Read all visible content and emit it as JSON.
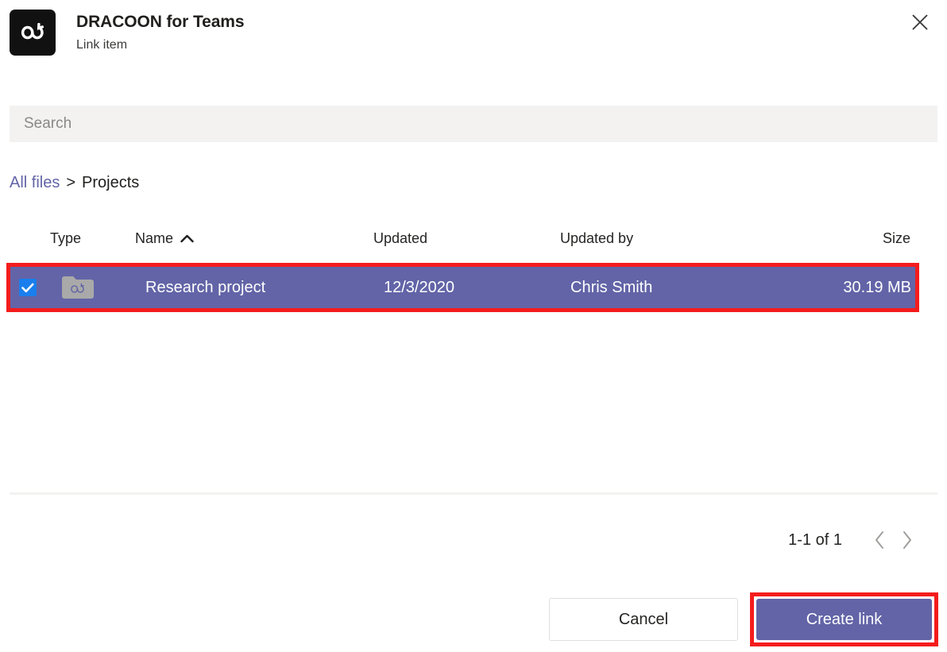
{
  "header": {
    "app_title": "DRACOON for Teams",
    "subtitle": "Link item",
    "logo_icon": "dracoon-infinity-logo",
    "close_icon": "close-icon"
  },
  "search": {
    "placeholder": "Search",
    "value": "",
    "icon": "search-input"
  },
  "breadcrumb": {
    "root_label": "All files",
    "separator": ">",
    "current_label": "Projects"
  },
  "table": {
    "columns": {
      "type": "Type",
      "name": "Name",
      "updated": "Updated",
      "updated_by": "Updated by",
      "size": "Size"
    },
    "sort": {
      "column": "Name",
      "direction": "ascending",
      "icon": "chevron-up-icon"
    },
    "rows": [
      {
        "selected": true,
        "checked": true,
        "type_icon": "folder-icon",
        "name": "Research project",
        "updated": "12/3/2020",
        "updated_by": "Chris Smith",
        "size": "30.19 MB"
      }
    ]
  },
  "pagination": {
    "range_label": "1-1 of 1",
    "prev_icon": "chevron-left-icon",
    "next_icon": "chevron-right-icon"
  },
  "footer": {
    "cancel_label": "Cancel",
    "create_label": "Create link"
  },
  "colors": {
    "accent_purple": "#6264a7",
    "checkbox_blue": "#1a7fed",
    "annotation_red": "#f41c1c",
    "search_bg": "#f3f2f1",
    "logo_bg": "#111111",
    "folder_gray": "#a9a9a9"
  }
}
